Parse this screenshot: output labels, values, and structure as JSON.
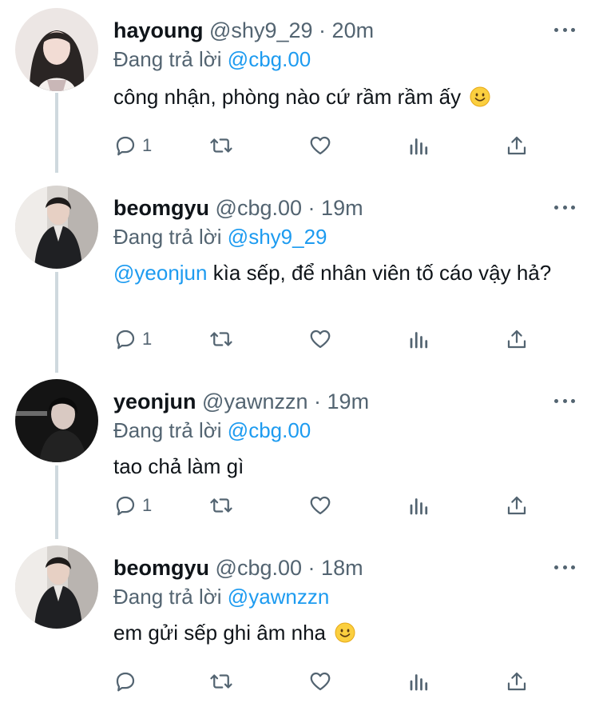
{
  "tweets": [
    {
      "name": "hayoung",
      "handle": "@shy9_29",
      "time": "20m",
      "replying_prefix": "Đang trả lời",
      "replying_to": "@cbg.00",
      "mention": "",
      "text": "công nhận, phòng nào cứ rầm rầm ấy",
      "reply_count": "1",
      "avatar_color": "#e9e1df"
    },
    {
      "name": "beomgyu",
      "handle": "@cbg.00",
      "time": "19m",
      "replying_prefix": "Đang trả lời",
      "replying_to": "@shy9_29",
      "mention": "@yeonjun",
      "text": " kìa sếp, để nhân viên tố cáo vậy hả?",
      "reply_count": "1",
      "avatar_color": "#3a3a3a"
    },
    {
      "name": "yeonjun",
      "handle": "@yawnzzn",
      "time": "19m",
      "replying_prefix": "Đang trả lời",
      "replying_to": "@cbg.00",
      "mention": "",
      "text": "tao chả làm gì",
      "reply_count": "1",
      "avatar_color": "#1c1c1c"
    },
    {
      "name": "beomgyu",
      "handle": "@cbg.00",
      "time": "18m",
      "replying_prefix": "Đang trả lời",
      "replying_to": "@yawnzzn",
      "mention": "",
      "text": "em gửi sếp ghi âm nha",
      "reply_count": "",
      "avatar_color": "#3a3a3a"
    }
  ],
  "separator": "·",
  "icons": [
    "reply-icon",
    "retweet-icon",
    "like-icon",
    "analytics-icon",
    "share-icon",
    "more-icon",
    "smile-emoji"
  ],
  "colors": {
    "link": "#1d9bf0",
    "muted": "#536471",
    "thread_line": "#cfd9de"
  }
}
